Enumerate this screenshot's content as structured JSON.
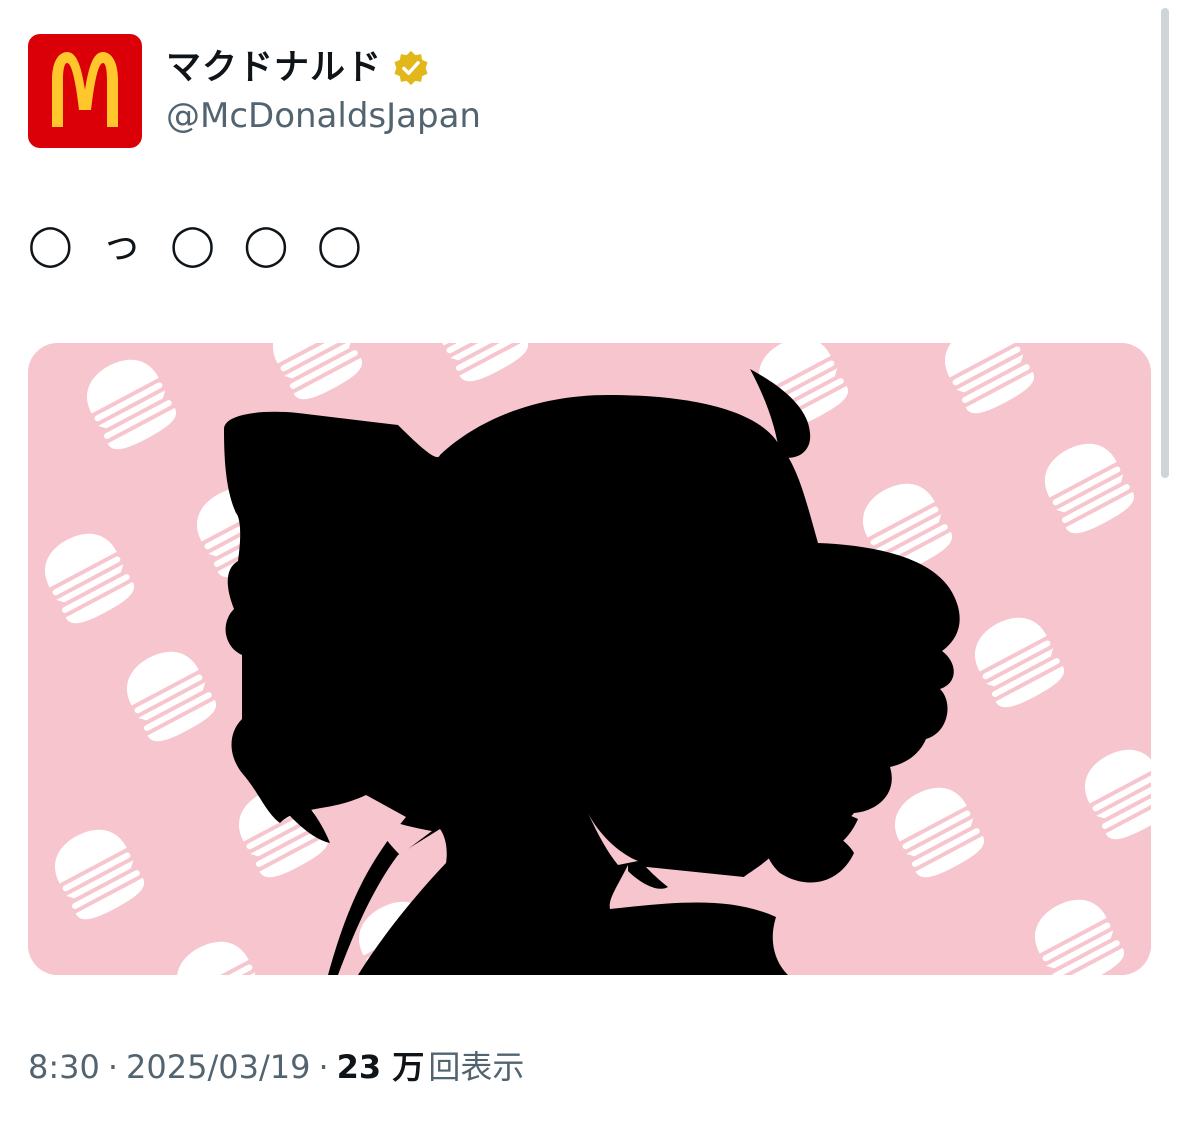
{
  "author": {
    "display_name": "マクドナルド",
    "handle": "@McDonaldsJapan",
    "avatar_icon": "mcdonalds-golden-arches-logo",
    "verified_icon": "verified-gold-badge-icon",
    "brand_red": "#db0007",
    "arches_yellow": "#ffc72c",
    "verified_gold": "#e2b719"
  },
  "tweet": {
    "text": "◯ っ ◯ ◯ ◯"
  },
  "media": {
    "kind": "image",
    "background_color": "#f6c5ce",
    "pattern_icon": "hamburger-icon",
    "subject": "silhouette-icon"
  },
  "meta": {
    "time": "8:30",
    "separator": "·",
    "date": "2025/03/19",
    "views_count": "23 万",
    "views_label": "回表示"
  },
  "colors": {
    "text_primary": "#0f1419",
    "text_secondary": "#536471"
  }
}
